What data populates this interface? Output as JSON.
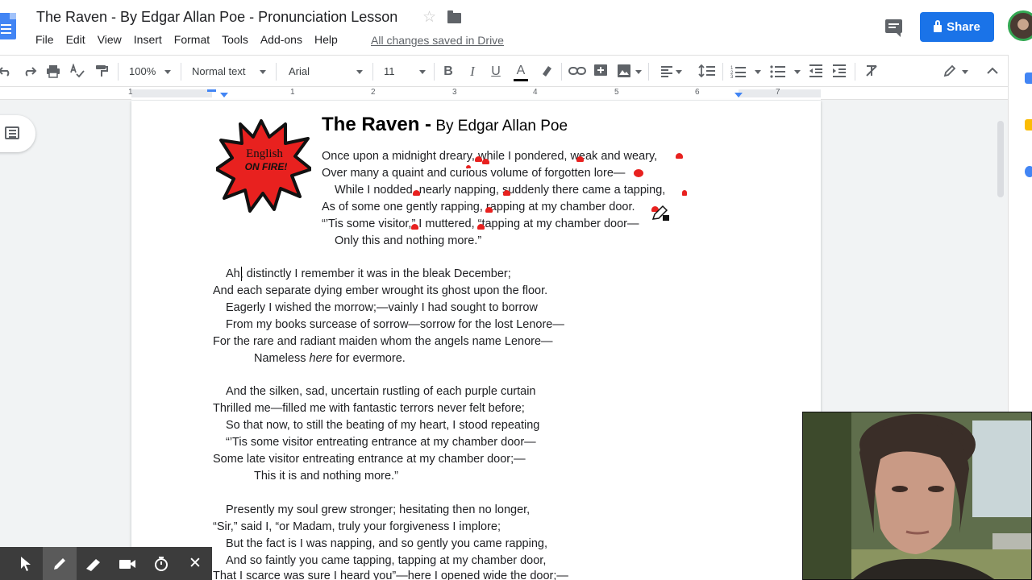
{
  "document": {
    "title": "The Raven - By Edgar Allan Poe - Pronunciation Lesson",
    "save_status": "All changes saved in Drive"
  },
  "menu": [
    "File",
    "Edit",
    "View",
    "Insert",
    "Format",
    "Tools",
    "Add-ons",
    "Help"
  ],
  "header": {
    "share_label": "Share",
    "icons": [
      "docs-icon",
      "star-icon",
      "folder-icon",
      "comments-icon",
      "lock-icon",
      "avatar"
    ]
  },
  "toolbar": {
    "zoom": "100%",
    "style": "Normal text",
    "font": "Arial",
    "font_size": "11",
    "bold": "B",
    "italic": "I",
    "underline": "U",
    "text_color": "A"
  },
  "ruler": {
    "numbers": [
      "1",
      "1",
      "2",
      "3",
      "4",
      "5",
      "6",
      "7"
    ]
  },
  "logo": {
    "line1": "English",
    "line2": "ON FIRE!"
  },
  "poem": {
    "title": "The Raven",
    "dash": " -",
    "byline": " By Edgar Allan Poe",
    "stanza1": [
      "Once upon a midnight dreary, while I pondered, weak and weary,",
      "Over many a quaint and curious volume of forgotten lore—",
      "While I nodded, nearly napping, suddenly there came a tapping,",
      "As of some one gently rapping, rapping at my chamber door.",
      "“’Tis some visitor,” I muttered, “tapping at my chamber door—",
      "Only this and nothing more.”"
    ],
    "stanza2": [
      "Ah, distinctly I remember it was in the bleak December;",
      "And each separate dying ember wrought its ghost upon the floor.",
      "Eagerly I wished the morrow;—vainly I had sought to borrow",
      "From my books surcease of sorrow—sorrow for the lost Lenore—",
      "For the rare and radiant maiden whom the angels name Lenore—"
    ],
    "stanza2_last": {
      "before": "Nameless ",
      "italic": "here",
      "after": " for evermore."
    },
    "stanza3": [
      "And the silken, sad, uncertain rustling of each purple curtain",
      "Thrilled me—filled me with fantastic terrors never felt before;",
      "So that now, to still the beating of my heart, I stood repeating",
      "“’Tis some visitor entreating entrance at my chamber door—",
      "Some late visitor entreating entrance at my chamber door;—",
      "This it is and nothing more.”"
    ],
    "stanza4": [
      "Presently my soul grew stronger; hesitating then no longer,",
      "“Sir,” said I, “or Madam, truly your forgiveness I implore;",
      "But the fact is I was napping, and so gently you came rapping,",
      "And so faintly you came tapping, tapping at my chamber door,",
      "That I scarce was sure I heard you”—here I opened wide the door;—"
    ]
  },
  "annotation": {
    "ink_color": "#e8211f"
  },
  "colors": {
    "share_blue": "#1a73e8",
    "ruler_blue": "#4285f4",
    "page_bg": "#ffffff",
    "canvas_bg": "#f1f3f4"
  },
  "recording_toolbar": {
    "tools": [
      "pointer-icon",
      "pen-icon",
      "highlighter-icon",
      "camera-icon",
      "timer-icon",
      "close-icon"
    ],
    "close_glyph": "✕"
  }
}
